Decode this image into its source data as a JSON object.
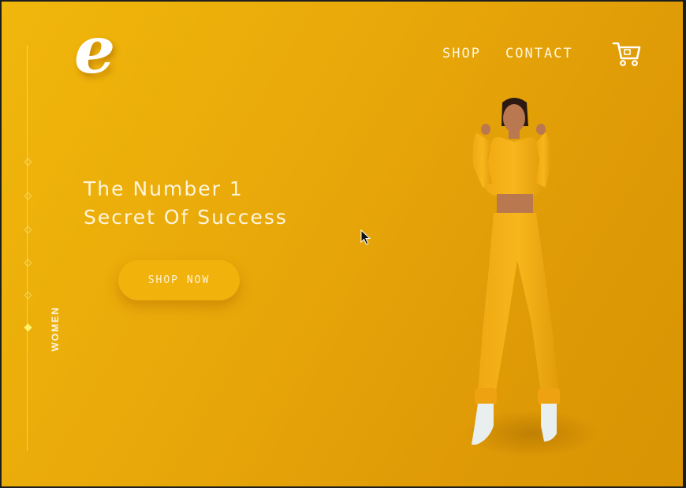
{
  "brand": {
    "logo_letter": "e"
  },
  "nav": {
    "items": [
      {
        "label": "SHOP"
      },
      {
        "label": "CONTACT"
      }
    ],
    "cart_icon": "cart-icon"
  },
  "side_nav": {
    "label": "WOMEN",
    "dots": 6,
    "active_index": 5
  },
  "hero": {
    "headline_line1": "The Number 1",
    "headline_line2": "Secret Of Success",
    "cta_label": "SHOP NOW",
    "image": "model-in-yellow-tracksuit"
  },
  "colors": {
    "background": "#e7a709",
    "button": "#f1b20c",
    "text": "#fff5dc",
    "accent": "#fff36b"
  }
}
